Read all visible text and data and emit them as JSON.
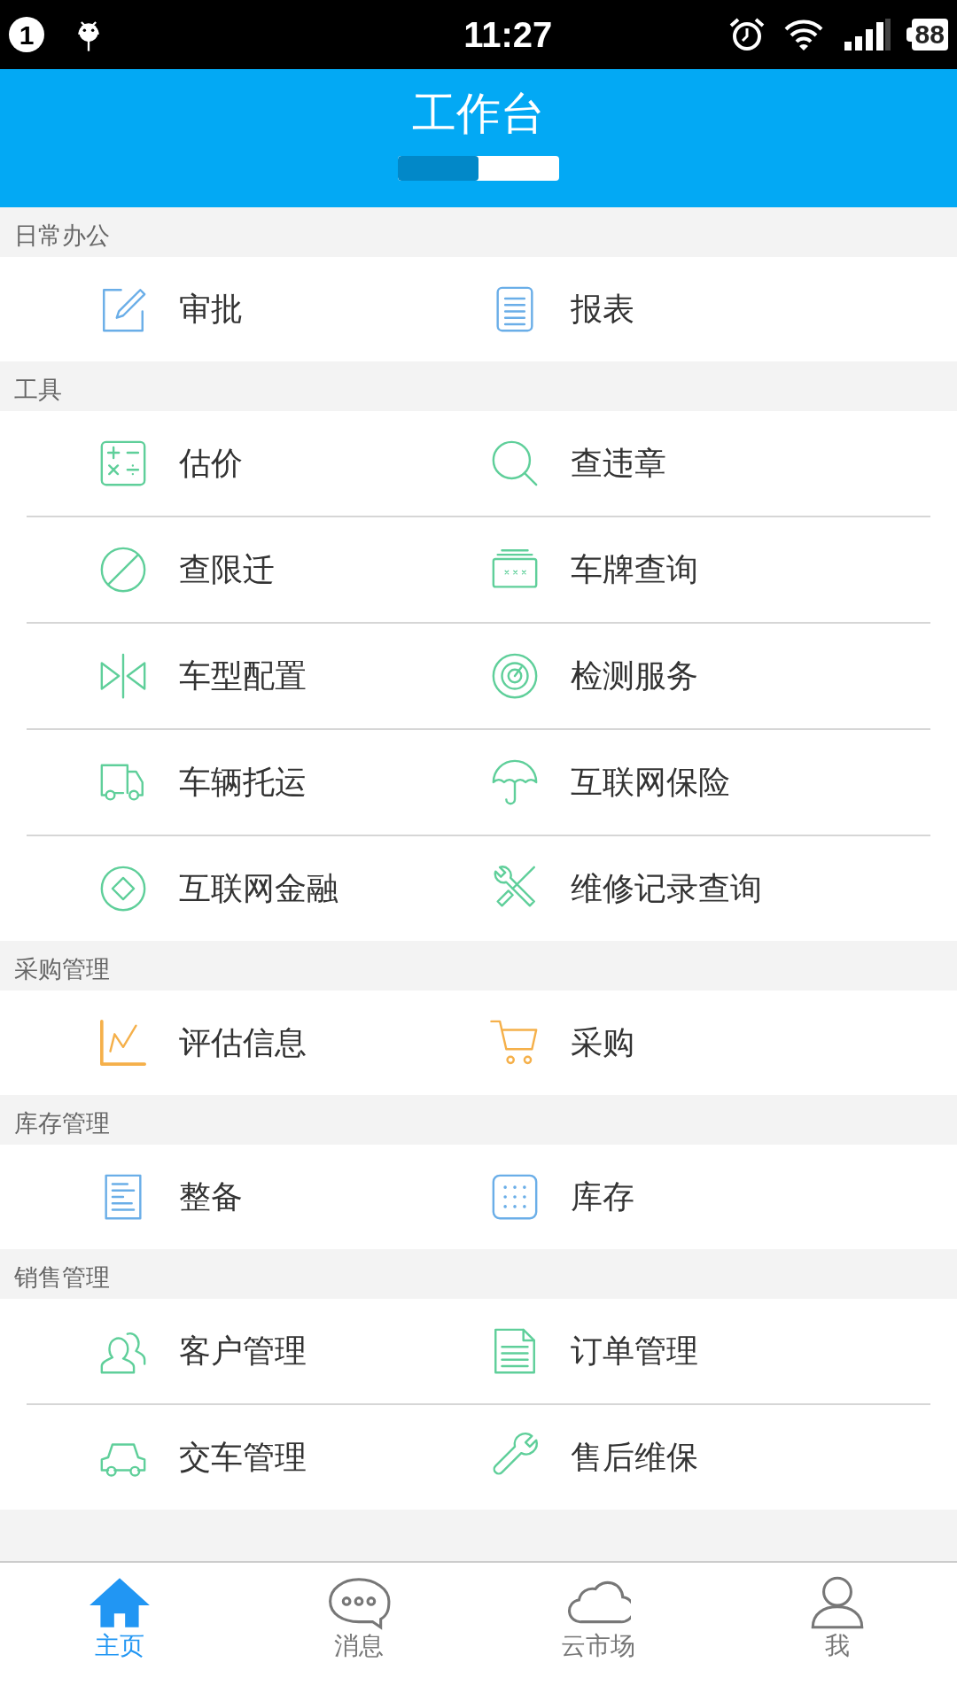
{
  "status_bar": {
    "notification_count": "1",
    "time": "11:27",
    "battery": "88"
  },
  "header": {
    "title": "工作台",
    "progress": {
      "level": 0.5
    }
  },
  "sections": [
    {
      "title": "日常办公",
      "rows": [
        [
          {
            "label": "审批",
            "kind": "edit"
          },
          {
            "label": "报表",
            "kind": "list"
          }
        ]
      ]
    },
    {
      "title": "工具",
      "rows": [
        [
          {
            "label": "估价",
            "kind": "calculator"
          },
          {
            "label": "查违章",
            "kind": "search"
          }
        ],
        [
          {
            "label": "查限迁",
            "kind": "forbidden"
          },
          {
            "label": "车牌查询",
            "kind": "plate"
          }
        ],
        [
          {
            "label": "车型配置",
            "kind": "compare"
          },
          {
            "label": "检测服务",
            "kind": "gauge"
          }
        ],
        [
          {
            "label": "车辆托运",
            "kind": "truck"
          },
          {
            "label": "互联网保险",
            "kind": "umbrella"
          }
        ],
        [
          {
            "label": "互联网金融",
            "kind": "diamond"
          },
          {
            "label": "维修记录查询",
            "kind": "tools"
          }
        ]
      ]
    },
    {
      "title": "采购管理",
      "rows": [
        [
          {
            "label": "评估信息",
            "kind": "chart"
          },
          {
            "label": "采购",
            "kind": "cart"
          }
        ]
      ]
    },
    {
      "title": "库存管理",
      "rows": [
        [
          {
            "label": "整备",
            "kind": "document"
          },
          {
            "label": "库存",
            "kind": "grid"
          }
        ]
      ]
    },
    {
      "title": "销售管理",
      "rows": [
        [
          {
            "label": "客户管理",
            "kind": "users"
          },
          {
            "label": "订单管理",
            "kind": "file"
          }
        ],
        [
          {
            "label": "交车管理",
            "kind": "car"
          },
          {
            "label": "售后维保",
            "kind": "wrench"
          }
        ]
      ]
    }
  ],
  "tabs": [
    {
      "label": "主页",
      "kind": "home",
      "selected": true
    },
    {
      "label": "消息",
      "kind": "chat",
      "selected": false
    },
    {
      "label": "云市场",
      "kind": "cloud",
      "selected": false
    },
    {
      "label": "我",
      "kind": "user",
      "selected": false
    }
  ]
}
